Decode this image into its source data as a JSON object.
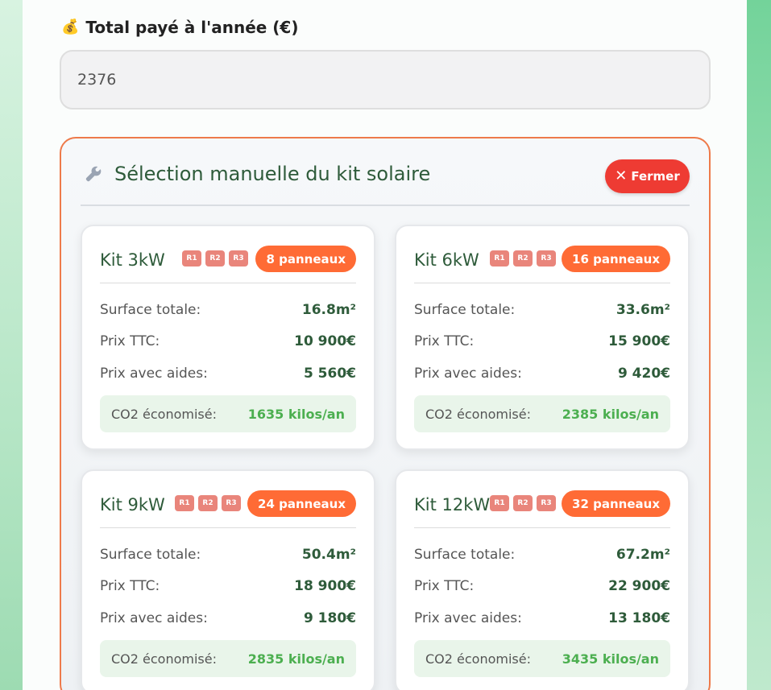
{
  "annual_total": {
    "icon": "money-bag-icon",
    "label": "Total payé à l'année (€)",
    "value": "2376"
  },
  "manual_selection": {
    "icon": "wrench-icon",
    "title": "Sélection manuelle du kit solaire",
    "close_label": "Fermer"
  },
  "labels": {
    "surface": "Surface totale:",
    "price": "Prix TTC:",
    "price_aid": "Prix avec aides:",
    "co2": "CO2 économisé:"
  },
  "kits": [
    {
      "name": "Kit 3kW",
      "tags": [
        "R1",
        "R2",
        "R3"
      ],
      "panels": "8 panneaux",
      "surface": "16.8m²",
      "price": "10 900€",
      "price_aid": "5 560€",
      "co2": "1635 kilos/an"
    },
    {
      "name": "Kit 6kW",
      "tags": [
        "R1",
        "R2",
        "R3"
      ],
      "panels": "16 panneaux",
      "surface": "33.6m²",
      "price": "15 900€",
      "price_aid": "9 420€",
      "co2": "2385 kilos/an"
    },
    {
      "name": "Kit 9kW",
      "tags": [
        "R1",
        "R2",
        "R3"
      ],
      "panels": "24 panneaux",
      "surface": "50.4m²",
      "price": "18 900€",
      "price_aid": "9 180€",
      "co2": "2835 kilos/an"
    },
    {
      "name": "Kit 12kW",
      "tags": [
        "R1",
        "R2",
        "R3"
      ],
      "panels": "32 panneaux",
      "surface": "67.2m²",
      "price": "22 900€",
      "price_aid": "13 180€",
      "co2": "3435 kilos/an"
    }
  ],
  "colors": {
    "accent": "#ff6b35",
    "close": "#ee3b33",
    "tag": "#e9857b",
    "green_text": "#2e5b3a",
    "co2_value": "#4caf50"
  }
}
